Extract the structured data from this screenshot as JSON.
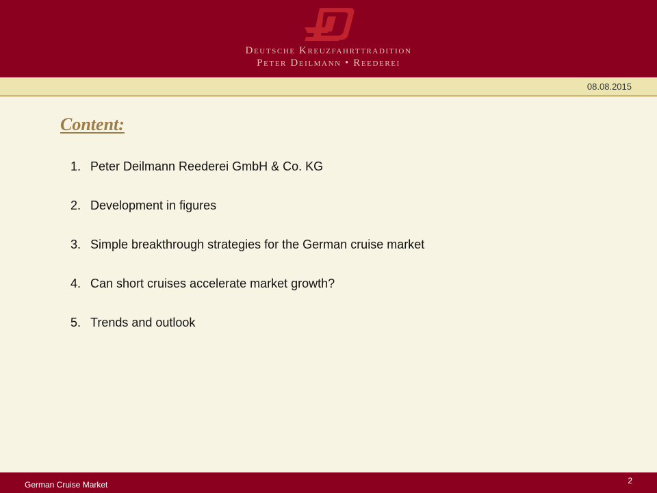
{
  "header": {
    "brand_line1": "Deutsche Kreuzfahrttradition",
    "brand_line2": "Peter Deilmann • Reederei",
    "logo_icon": "peter-deilmann-logo",
    "color_bg": "#8b001e"
  },
  "date": "08.08.2015",
  "slide": {
    "title": "Content:",
    "items": [
      {
        "num": "1.",
        "text": "Peter Deilmann Reederei GmbH & Co. KG"
      },
      {
        "num": "2.",
        "text": "Development in figures"
      },
      {
        "num": "3.",
        "text": "Simple breakthrough strategies for the German cruise market"
      },
      {
        "num": "4.",
        "text": "Can short cruises accelerate market growth?"
      },
      {
        "num": "5.",
        "text": "Trends and outlook"
      }
    ]
  },
  "footer": {
    "label": "German Cruise Market",
    "page": "2"
  }
}
